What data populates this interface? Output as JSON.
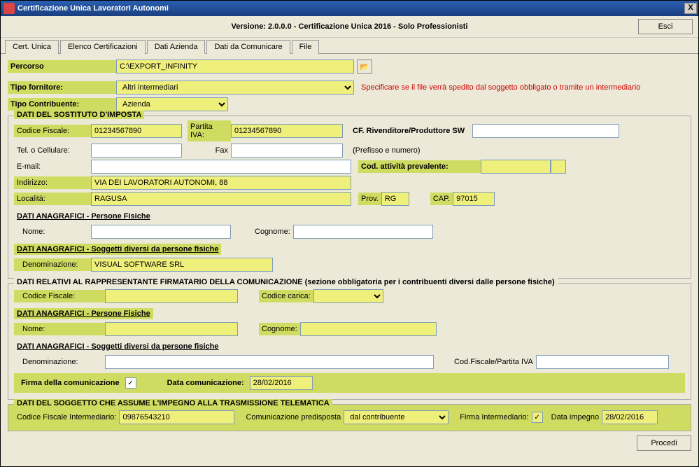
{
  "titlebar": {
    "title": "Certificazione Unica Lavoratori Autonomi",
    "close": "X"
  },
  "header": {
    "version": "Versione: 2.0.0.0 - Certificazione Unica 2016 - Solo Professionisti",
    "esci": "Esci"
  },
  "tabs": {
    "cert_unica": "Cert. Unica",
    "elenco": "Elenco Certificazioni",
    "dati_azienda": "Dati Azienda",
    "dati_comunicare": "Dati da Comunicare",
    "file": "File"
  },
  "percorso": {
    "label": "Percorso",
    "value": "C:\\EXPORT_INFINITY"
  },
  "tipo_fornitore": {
    "label": "Tipo fornitore:",
    "value": "Altri intermediari",
    "helper": "Specificare se il file verrà spedito dal soggetto obbligato o tramite un intermediario"
  },
  "tipo_contribuente": {
    "label": "Tipo Contribuente:",
    "value": "Azienda"
  },
  "sostituto": {
    "legend": "DATI DEL SOSTITUTO D'IMPOSTA",
    "cf_label": "Codice Fiscale:",
    "cf_value": "01234567890",
    "piva_label": "Partita IVA:",
    "piva_value": "01234567890",
    "cf_riv_label": "CF. Rivenditore/Produttore SW",
    "cf_riv_value": "",
    "tel_label": "Tel. o Cellulare:",
    "fax_label": "Fax",
    "prefisso": "(Prefisso e numero)",
    "email_label": "E-mail:",
    "cod_att_label": "Cod. attività prevalente:",
    "cod_att_value": "",
    "indirizzo_label": "Indirizzo:",
    "indirizzo_value": "VIA DEI LAVORATORI AUTONOMI, 88",
    "localita_label": "Località:",
    "localita_value": "RAGUSA",
    "prov_label": "Prov.",
    "prov_value": "RG",
    "cap_label": "CAP.",
    "cap_value": "97015"
  },
  "anag_pf": {
    "header": "DATI ANAGRAFICI - Persone Fisiche",
    "nome_label": "Nome:",
    "cognome_label": "Cognome:"
  },
  "anag_sd": {
    "header": "DATI ANAGRAFICI - Soggetti diversi da persone fisiche",
    "denom_label": "Denominazione:",
    "denom_value": "VISUAL SOFTWARE SRL"
  },
  "rappresentante": {
    "legend": "DATI RELATIVI AL RAPPRESENTANTE FIRMATARIO DELLA COMUNICAZIONE (sezione obbligatoria per i contribuenti diversi dalle persone fisiche)",
    "cf_label": "Codice Fiscale:",
    "cc_label": "Codice carica:",
    "pf_header": "DATI ANAGRAFICI - Persone Fisiche",
    "nome_label": "Nome:",
    "cognome_label": "Cognome:",
    "sd_header": "DATI ANAGRAFICI - Soggetti diversi da persone fisiche",
    "denom_label": "Denominazione:",
    "cfpiva_label": "Cod.Fiscale/Partita IVA"
  },
  "firma": {
    "firma_label": "Firma della comunicazione",
    "data_label": "Data comunicazione:",
    "data_value": "28/02/2016"
  },
  "trasmissione": {
    "legend": "DATI DEL SOGGETTO CHE ASSUME L'IMPEGNO ALLA TRASMISSIONE TELEMATICA",
    "cf_label": "Codice Fiscale Intermediario:",
    "cf_value": "09876543210",
    "comp_label": "Comunicazione predisposta",
    "comp_value": "dal contribuente",
    "firma_label": "Firma Intermediario:",
    "data_label": "Data impegno",
    "data_value": "28/02/2016"
  },
  "procedi": "Procedi"
}
